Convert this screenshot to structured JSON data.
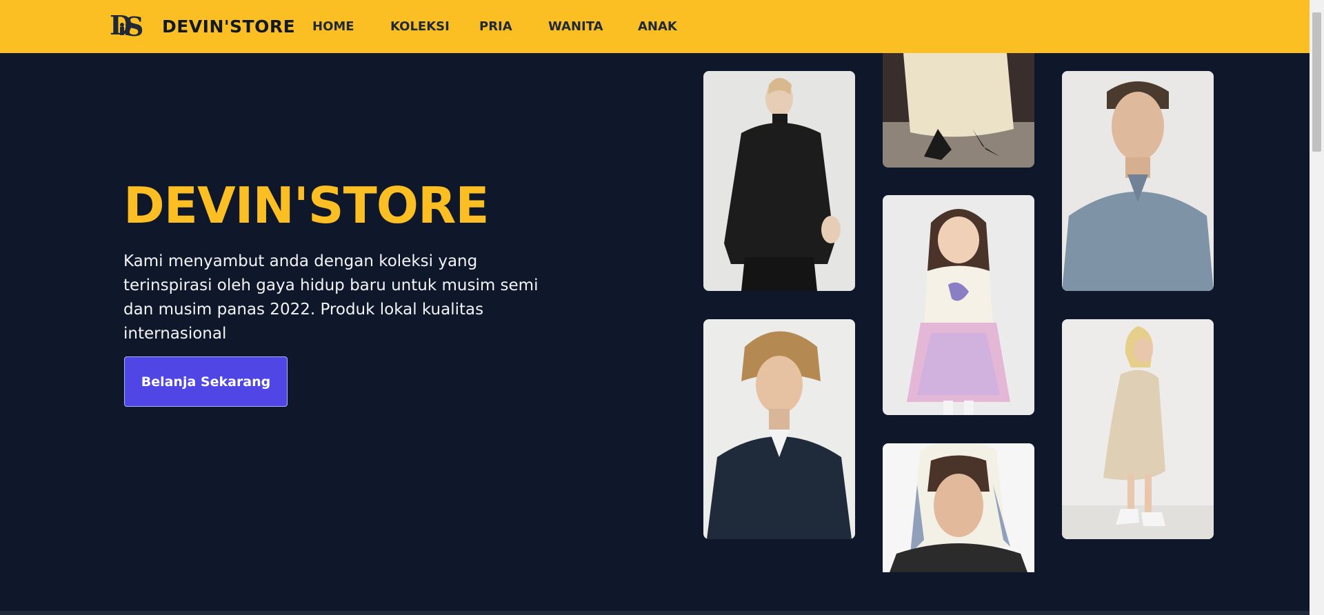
{
  "header": {
    "logo_text": "DS",
    "brand": "DEVIN'STORE",
    "nav": [
      {
        "label": "HOME"
      },
      {
        "label": "KOLEKSI"
      },
      {
        "label": "PRIA"
      },
      {
        "label": "WANITA"
      },
      {
        "label": "ANAK"
      }
    ]
  },
  "hero": {
    "title": "DEVIN'STORE",
    "description": "Kami menyambut anda dengan koleksi yang terinspirasi oleh gaya hidup baru untuk musim semi dan musim panas 2022. Produk lokal kualitas internasional",
    "cta_label": "Belanja Sekarang"
  },
  "colors": {
    "header_bg": "#fbbf24",
    "page_bg": "#0f172a",
    "accent": "#fbbf24",
    "button_bg": "#4f46e5"
  },
  "gallery": {
    "photos": [
      {
        "name": "woman-black-pleated-top"
      },
      {
        "name": "woman-cream-dress-sandals"
      },
      {
        "name": "man-blue-shirt"
      },
      {
        "name": "girl-unicorn-tulle-dress"
      },
      {
        "name": "man-navy-shirt"
      },
      {
        "name": "woman-beige-shirt-dress"
      },
      {
        "name": "woman-printed-headscarf"
      }
    ]
  }
}
